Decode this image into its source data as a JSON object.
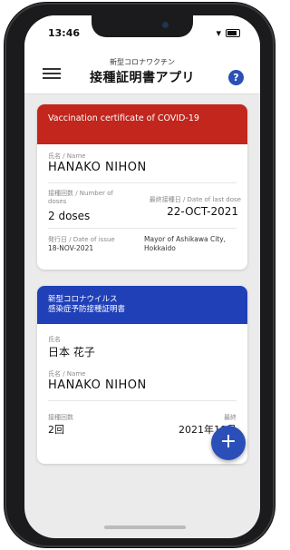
{
  "status": {
    "time": "13:46"
  },
  "header": {
    "subtitle": "新型コロナワクチン",
    "title": "接種証明書アプリ",
    "help_glyph": "?"
  },
  "cards": [
    {
      "header": "Vaccination certificate of COVID-19",
      "color": "#c2261c",
      "name_label": "氏名 / Name",
      "name": "HANAKO  NIHON",
      "doses_label": "接種回数 / Number of doses",
      "doses": "2 doses",
      "last_dose_label": "最終接種日 / Date of last dose",
      "last_dose": "22-OCT-2021",
      "issue_label": "発行日 / Date of issue",
      "issue_date": "18-NOV-2021",
      "issuer": "Mayor of Ashikawa City, Hokkaido"
    },
    {
      "header_line1": "新型コロナウイルス",
      "header_line2": "感染症予防接種証明書",
      "color": "#2040b8",
      "name_label_jp": "氏名",
      "name_jp": "日本 花子",
      "name_label": "氏名 / Name",
      "name": "HANAKO  NIHON",
      "doses_label": "接種回数",
      "doses": "2回",
      "last_dose_label": "最終",
      "last_dose": "2021年10月"
    }
  ],
  "fab": {
    "glyph": "+"
  }
}
